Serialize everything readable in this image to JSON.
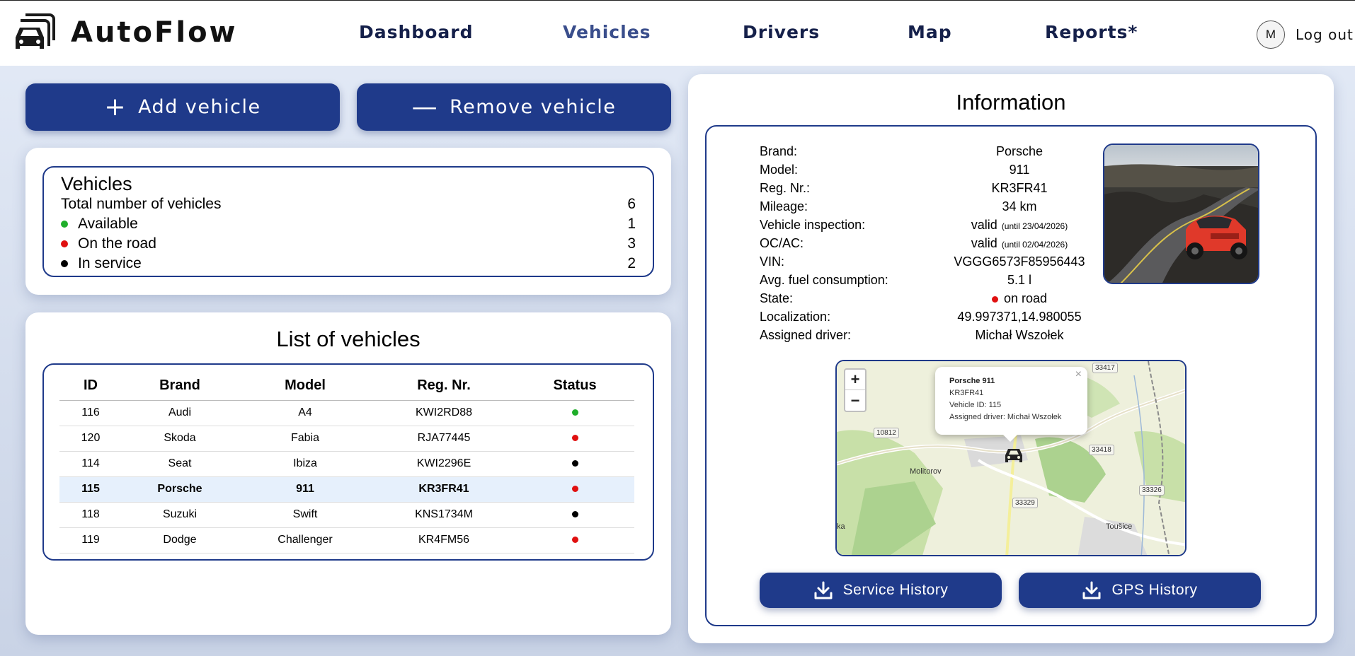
{
  "header": {
    "brand": "AutoFlow",
    "nav": [
      "Dashboard",
      "Vehicles",
      "Drivers",
      "Map",
      "Reports*"
    ],
    "active_nav": "Vehicles",
    "avatar_initial": "M",
    "logout_label": "Log out"
  },
  "actions": {
    "add_label": "Add vehicle",
    "remove_label": "Remove vehicle",
    "add_symbol": "+",
    "remove_symbol": "—"
  },
  "summary": {
    "title": "Vehicles",
    "total_label": "Total number of vehicles",
    "total_value": "6",
    "rows": [
      {
        "label": "Available",
        "value": "1",
        "color": "#1fae2a"
      },
      {
        "label": "On the road",
        "value": "3",
        "color": "#e01010"
      },
      {
        "label": "In service",
        "value": "2",
        "color": "#000000"
      }
    ]
  },
  "vehicle_list": {
    "title": "List of vehicles",
    "columns": [
      "ID",
      "Brand",
      "Model",
      "Reg. Nr.",
      "Status"
    ],
    "rows": [
      {
        "id": "116",
        "brand": "Audi",
        "model": "A4",
        "reg": "KWI2RD88",
        "status_color": "#1fae2a"
      },
      {
        "id": "120",
        "brand": "Skoda",
        "model": "Fabia",
        "reg": "RJA77445",
        "status_color": "#e01010"
      },
      {
        "id": "114",
        "brand": "Seat",
        "model": "Ibiza",
        "reg": "KWI2296E",
        "status_color": "#000000"
      },
      {
        "id": "115",
        "brand": "Porsche",
        "model": "911",
        "reg": "KR3FR41",
        "status_color": "#e01010",
        "selected": true
      },
      {
        "id": "118",
        "brand": "Suzuki",
        "model": "Swift",
        "reg": "KNS1734M",
        "status_color": "#000000"
      },
      {
        "id": "119",
        "brand": "Dodge",
        "model": "Challenger",
        "reg": "KR4FM56",
        "status_color": "#e01010"
      }
    ]
  },
  "info": {
    "title": "Information",
    "labels": {
      "brand": "Brand:",
      "model": "Model:",
      "reg": "Reg. Nr.:",
      "mileage": "Mileage:",
      "inspection": "Vehicle inspection:",
      "ocac": "OC/AC:",
      "vin": "VIN:",
      "fuel": "Avg. fuel consumption:",
      "state": "State:",
      "localization": "Localization:",
      "driver": "Assigned driver:"
    },
    "values": {
      "brand": "Porsche",
      "model": "911",
      "reg": "KR3FR41",
      "mileage": "34 km",
      "inspection": "valid",
      "inspection_note": "(until 23/04/2026)",
      "ocac": "valid",
      "ocac_note": "(until 02/04/2026)",
      "vin": "VGGG6573F85956443",
      "fuel": "5.1 l",
      "state": "on road",
      "state_color": "#e01010",
      "localization": "49.997371,14.980055",
      "driver": "Michał Wszołek"
    },
    "map": {
      "zoom_in": "+",
      "zoom_out": "−",
      "close": "×",
      "popup_title": "Porsche 911",
      "popup_reg": "KR3FR41",
      "popup_vehicle_id": "Vehicle ID: 115",
      "popup_driver": "Assigned driver: Michał Wszołek",
      "road_labels": [
        "33417",
        "10812",
        "33418",
        "33326",
        "33329"
      ],
      "towns": [
        "Molitorov",
        "Toušice"
      ],
      "edge_text": "ka"
    },
    "service_history_label": "Service History",
    "gps_history_label": "GPS History"
  }
}
